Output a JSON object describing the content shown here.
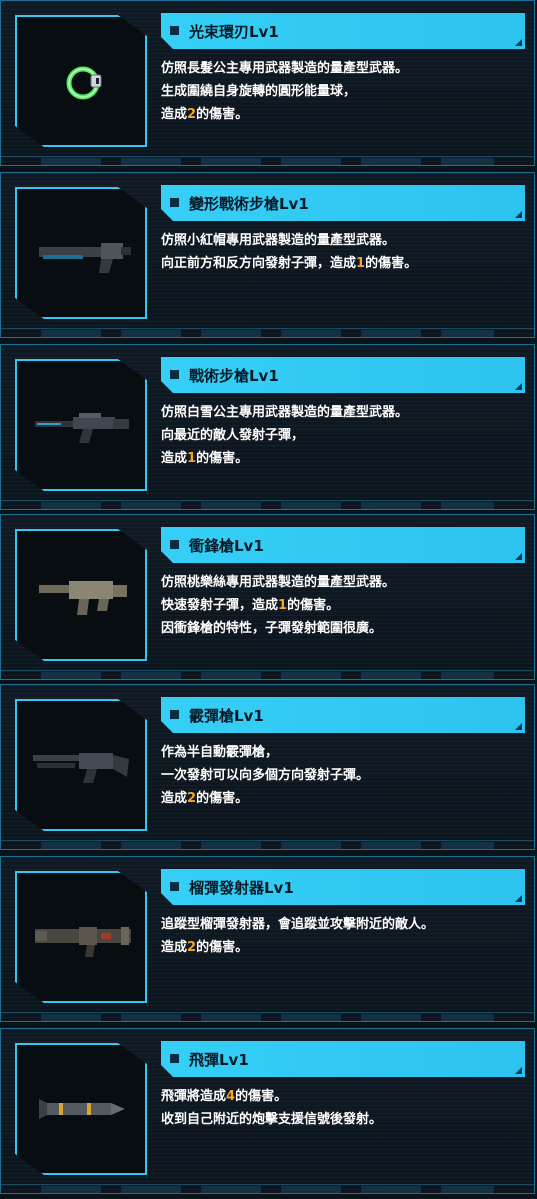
{
  "weapons": [
    {
      "name": "光束環刃Lv1",
      "icon": "beam-ring-blade-icon",
      "lines": [
        {
          "before": "仿照長髮公主專用武器製造的量產型武器。",
          "num": "",
          "after": ""
        },
        {
          "before": "生成圍繞自身旋轉的圓形能量球，",
          "num": "",
          "after": ""
        },
        {
          "before": "造成",
          "num": "2",
          "after": "的傷害。"
        }
      ]
    },
    {
      "name": "變形戰術步槍Lv1",
      "icon": "transform-tactical-rifle-icon",
      "lines": [
        {
          "before": "仿照小紅帽專用武器製造的量產型武器。",
          "num": "",
          "after": ""
        },
        {
          "before": "向正前方和反方向發射子彈，造成",
          "num": "1",
          "after": "的傷害。"
        }
      ]
    },
    {
      "name": "戰術步槍Lv1",
      "icon": "tactical-rifle-icon",
      "lines": [
        {
          "before": "仿照白雪公主專用武器製造的量產型武器。",
          "num": "",
          "after": ""
        },
        {
          "before": "向最近的敵人發射子彈，",
          "num": "",
          "after": ""
        },
        {
          "before": "造成",
          "num": "1",
          "after": "的傷害。"
        }
      ]
    },
    {
      "name": "衝鋒槍Lv1",
      "icon": "submachine-gun-icon",
      "lines": [
        {
          "before": "仿照桃樂絲專用武器製造的量產型武器。",
          "num": "",
          "after": ""
        },
        {
          "before": "快速發射子彈，造成",
          "num": "1",
          "after": "的傷害。"
        },
        {
          "before": "因衝鋒槍的特性，子彈發射範圍很廣。",
          "num": "",
          "after": ""
        }
      ]
    },
    {
      "name": "霰彈槍Lv1",
      "icon": "shotgun-icon",
      "lines": [
        {
          "before": "作為半自動霰彈槍，",
          "num": "",
          "after": ""
        },
        {
          "before": "一次發射可以向多個方向發射子彈。",
          "num": "",
          "after": ""
        },
        {
          "before": "造成",
          "num": "2",
          "after": "的傷害。"
        }
      ]
    },
    {
      "name": "榴彈發射器Lv1",
      "icon": "grenade-launcher-icon",
      "lines": [
        {
          "before": "追蹤型榴彈發射器，會追蹤並攻擊附近的敵人。",
          "num": "",
          "after": ""
        },
        {
          "before": "造成",
          "num": "2",
          "after": "的傷害。"
        }
      ]
    },
    {
      "name": "飛彈Lv1",
      "icon": "missile-icon",
      "lines": [
        {
          "before": "飛彈將造成",
          "num": "4",
          "after": "的傷害。"
        },
        {
          "before": "收到自己附近的炮擊支援信號後發射。",
          "num": "",
          "after": ""
        }
      ]
    }
  ],
  "colors": {
    "accent": "#35cff6",
    "damage_number": "#f5a623",
    "text": "#ffffff",
    "title_text": "#071a28"
  }
}
